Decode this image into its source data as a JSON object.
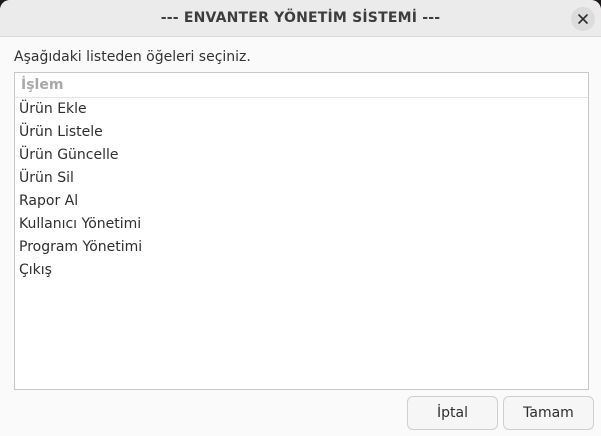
{
  "window": {
    "title": "--- ENVANTER YÖNETİM SİSTEMİ ---",
    "close_icon": "close-icon"
  },
  "prompt": "Aşağıdaki listeden öğeleri seçiniz.",
  "list": {
    "column_header": "İşlem",
    "items": [
      "Ürün Ekle",
      "Ürün Listele",
      "Ürün Güncelle",
      "Ürün Sil",
      "Rapor Al",
      "Kullanıcı Yönetimi",
      "Program Yönetimi",
      "Çıkış"
    ]
  },
  "buttons": {
    "cancel_label": "İptal",
    "ok_label": "Tamam"
  }
}
